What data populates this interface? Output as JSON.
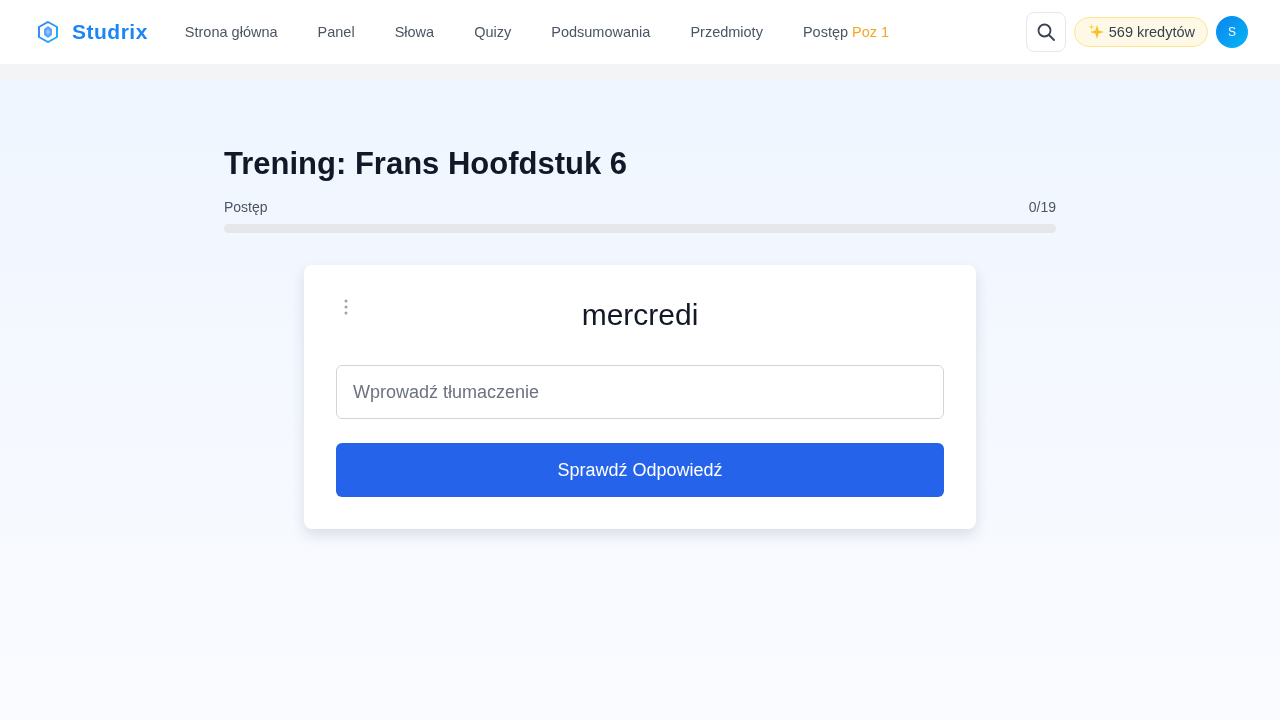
{
  "header": {
    "logo": "Studrix",
    "nav": [
      {
        "label": "Strona główna"
      },
      {
        "label": "Panel"
      },
      {
        "label": "Słowa"
      },
      {
        "label": "Quizy"
      },
      {
        "label": "Podsumowania"
      },
      {
        "label": "Przedmioty"
      },
      {
        "label": "Postęp",
        "badge": "Poz 1"
      }
    ],
    "credits": "569 kredytów",
    "avatar": "S"
  },
  "title": "Trening: Frans Hoofdstuk 6",
  "progress": {
    "label": "Postęp",
    "count": "0/19",
    "level": 0
  },
  "card": {
    "word": "mercredi",
    "answer": {
      "placeholder": "Wprowadź tłumaczenie"
    },
    "button": "Sprawdź Odpowiedź"
  }
}
